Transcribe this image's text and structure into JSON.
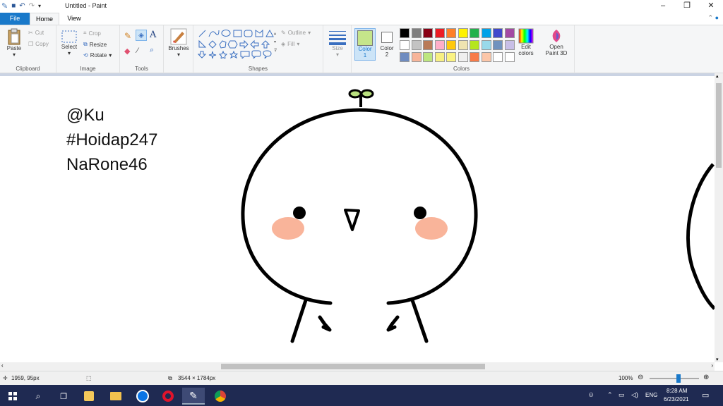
{
  "window": {
    "title": "Untitled - Paint"
  },
  "tabs": {
    "file": "File",
    "home": "Home",
    "view": "View"
  },
  "ribbon": {
    "clipboard": {
      "label": "Clipboard",
      "paste": "Paste",
      "cut": "Cut",
      "copy": "Copy"
    },
    "image": {
      "label": "Image",
      "select": "Select",
      "crop": "Crop",
      "resize": "Resize",
      "rotate": "Rotate"
    },
    "tools": {
      "label": "Tools"
    },
    "brushes": {
      "label": "Brushes"
    },
    "shapes": {
      "label": "Shapes",
      "outline": "Outline",
      "fill": "Fill"
    },
    "size": {
      "label": "Size"
    },
    "color1": {
      "label": "Color",
      "num": "1",
      "value": "#c5e58a"
    },
    "color2": {
      "label": "Color",
      "num": "2",
      "value": "#ffffff"
    },
    "colors": {
      "label": "Colors",
      "edit": "Edit colors",
      "edit_line1": "Edit",
      "edit_line2": "colors",
      "row1": [
        "#000000",
        "#7f7f7f",
        "#880015",
        "#ed1c24",
        "#ff7f27",
        "#fff200",
        "#22b14c",
        "#00a2e8",
        "#3f48cc",
        "#a349a4"
      ],
      "row2": [
        "#ffffff",
        "#c3c3c3",
        "#b97a57",
        "#ffaec9",
        "#ffc90e",
        "#efe4b0",
        "#b5e61d",
        "#99d9ea",
        "#7092be",
        "#c8bfe7"
      ],
      "row3": [
        "#6f8cc0",
        "#f7b59a",
        "#bde67f",
        "#f7ef83",
        "#faf282",
        "#efefef",
        "#f87c4a",
        "#fcc6a8",
        "#ffffff",
        "#ffffff"
      ]
    },
    "paint3d": {
      "line1": "Open",
      "line2": "Paint 3D"
    }
  },
  "canvas_text": {
    "line1": "@Ku",
    "line2": "#Hoidap247",
    "line3": "NaRone46"
  },
  "status": {
    "cursor": "1959, 95px",
    "size": "3544 × 1784px",
    "zoom": "100%",
    "zoom_fraction": 0.6
  },
  "taskbar": {
    "lang": "ENG",
    "time": "8:28 AM",
    "date": "6/23/2021"
  }
}
